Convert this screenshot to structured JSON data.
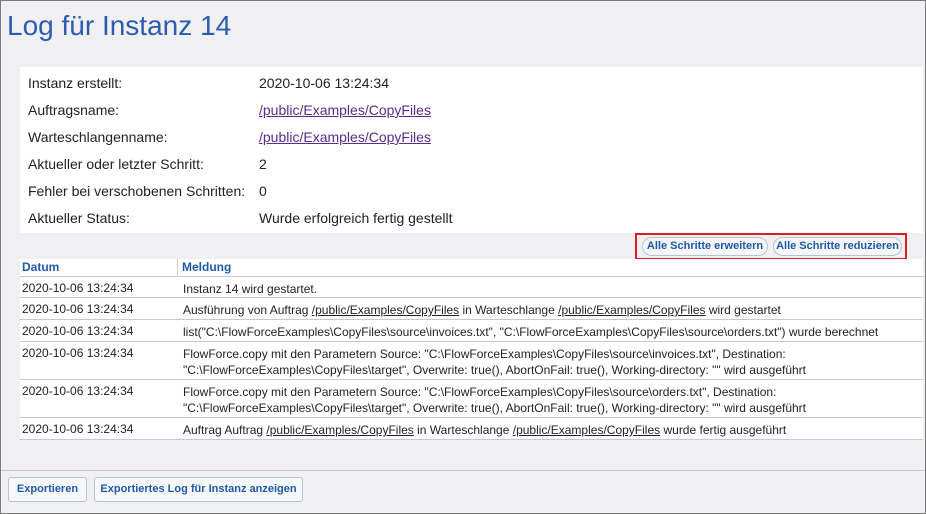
{
  "page": {
    "title": "Log für Instanz 14"
  },
  "info": [
    {
      "label": "Instanz erstellt:",
      "value": "2020-10-06 13:24:34",
      "is_link": false
    },
    {
      "label": "Auftragsname:",
      "value": "/public/Examples/CopyFiles",
      "is_link": true
    },
    {
      "label": "Warteschlangenname:",
      "value": "/public/Examples/CopyFiles",
      "is_link": true
    },
    {
      "label": "Aktueller oder letzter Schritt:",
      "value": "2",
      "is_link": false
    },
    {
      "label": "Fehler bei verschobenen Schritten:",
      "value": "0",
      "is_link": false
    },
    {
      "label": "Aktueller Status:",
      "value": "Wurde erfolgreich fertig gestellt",
      "is_link": false
    }
  ],
  "steps": {
    "expand_label": "Alle Schritte erweitern",
    "collapse_label": "Alle Schritte reduzieren"
  },
  "log": {
    "headers": {
      "date": "Datum",
      "message": "Meldung"
    },
    "rows": [
      {
        "date": "2020-10-06 13:24:34",
        "parts": [
          {
            "t": "Instanz 14 wird gestartet."
          }
        ]
      },
      {
        "date": "2020-10-06 13:24:34",
        "parts": [
          {
            "t": "Ausführung von Auftrag "
          },
          {
            "t": "/public/Examples/CopyFiles",
            "link": true
          },
          {
            "t": " in Warteschlange "
          },
          {
            "t": "/public/Examples/CopyFiles",
            "link": true
          },
          {
            "t": " wird gestartet"
          }
        ]
      },
      {
        "date": "2020-10-06 13:24:34",
        "parts": [
          {
            "t": "list(\"C:\\FlowForceExamples\\CopyFiles\\source\\invoices.txt\", \"C:\\FlowForceExamples\\CopyFiles\\source\\orders.txt\") wurde berechnet"
          }
        ]
      },
      {
        "date": "2020-10-06 13:24:34",
        "parts": [
          {
            "t": "FlowForce.copy mit den Parametern Source: \"C:\\FlowForceExamples\\CopyFiles\\source\\invoices.txt\", Destination: \"C:\\FlowForceExamples\\CopyFiles\\target\", Overwrite: true(), AbortOnFail: true(), Working-directory: \"\" wird ausgeführt"
          }
        ]
      },
      {
        "date": "2020-10-06 13:24:34",
        "parts": [
          {
            "t": "FlowForce.copy mit den Parametern Source: \"C:\\FlowForceExamples\\CopyFiles\\source\\orders.txt\", Destination: \"C:\\FlowForceExamples\\CopyFiles\\target\", Overwrite: true(), AbortOnFail: true(), Working-directory: \"\" wird ausgeführt"
          }
        ]
      },
      {
        "date": "2020-10-06 13:24:34",
        "parts": [
          {
            "t": "Auftrag Auftrag "
          },
          {
            "t": "/public/Examples/CopyFiles",
            "link": true
          },
          {
            "t": " in Warteschlange "
          },
          {
            "t": "/public/Examples/CopyFiles",
            "link": true
          },
          {
            "t": " wurde fertig ausgeführt"
          }
        ]
      }
    ]
  },
  "footer": {
    "export_label": "Exportieren",
    "show_export_label": "Exportiertes Log für Instanz anzeigen"
  },
  "colors": {
    "title": "#2a5db0",
    "link_visited": "#5b2a8c",
    "button_text": "#1f5aa8",
    "highlight_frame": "#d61f26"
  }
}
